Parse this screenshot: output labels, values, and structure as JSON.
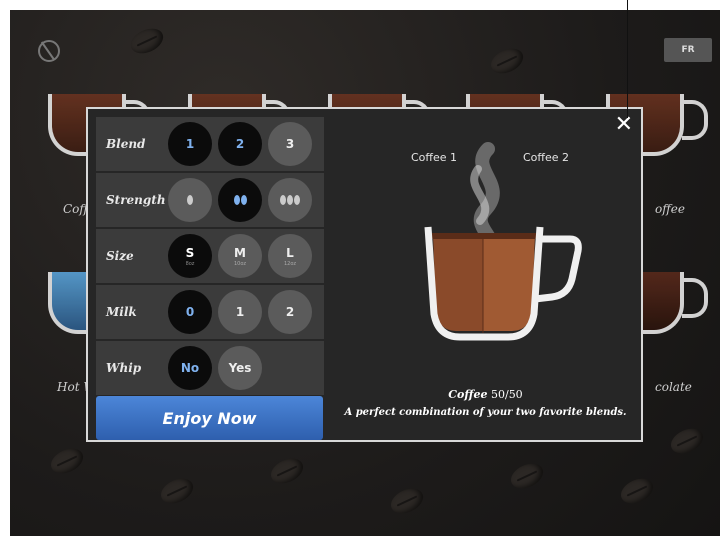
{
  "app": {
    "language_button": "FR",
    "background_drinks": [
      {
        "label": "Coff"
      },
      {
        "label": "offee"
      },
      {
        "label": "Hot W"
      },
      {
        "label": "colate"
      }
    ]
  },
  "modal": {
    "close_icon": "close-icon",
    "options": [
      {
        "label": "Blend",
        "choices": [
          {
            "text": "1",
            "selected": true
          },
          {
            "text": "2",
            "selected": true
          },
          {
            "text": "3",
            "selected": false
          }
        ]
      },
      {
        "label": "Strength",
        "choices": [
          {
            "icon": "bean-mild-icon",
            "selected": false
          },
          {
            "icon": "bean-medium-icon",
            "selected": true
          },
          {
            "icon": "bean-strong-icon",
            "selected": false
          }
        ]
      },
      {
        "label": "Size",
        "choices": [
          {
            "text": "S",
            "sub": "8oz",
            "selected": true
          },
          {
            "text": "M",
            "sub": "10oz",
            "selected": false
          },
          {
            "text": "L",
            "sub": "12oz",
            "selected": false
          }
        ]
      },
      {
        "label": "Milk",
        "choices": [
          {
            "text": "0",
            "selected": true
          },
          {
            "text": "1",
            "selected": false
          },
          {
            "text": "2",
            "selected": false
          }
        ]
      },
      {
        "label": "Whip",
        "choices": [
          {
            "text": "No",
            "selected": true
          },
          {
            "text": "Yes",
            "selected": false
          }
        ]
      }
    ],
    "enjoy_label": "Enjoy Now",
    "preview": {
      "coffee1_label": "Coffee 1",
      "coffee2_label": "Coffee 2",
      "title_brand": "Coffee",
      "title_ratio": "50/50",
      "subtitle": "A perfect combination of your two favorite blends."
    }
  }
}
